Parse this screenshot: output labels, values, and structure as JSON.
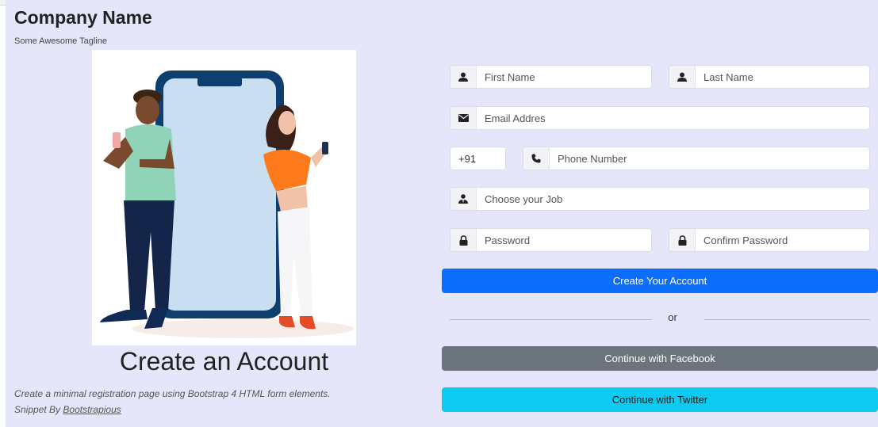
{
  "brand": {
    "name": "Company Name",
    "tagline": "Some Awesome Tagline"
  },
  "hero": {
    "title": "Create an Account",
    "description": "Create a minimal registration page using Bootstrap 4 HTML form elements.",
    "credit_prefix": "Snippet By",
    "credit_link": "Bootstrapious"
  },
  "form": {
    "first_name": {
      "placeholder": "First Name",
      "icon": "user-icon"
    },
    "last_name": {
      "placeholder": "Last Name",
      "icon": "user-icon"
    },
    "email": {
      "placeholder": "Email Addres",
      "icon": "envelope-icon"
    },
    "country_code": {
      "value": "+91"
    },
    "phone": {
      "placeholder": "Phone Number",
      "icon": "phone-icon"
    },
    "job": {
      "placeholder": "Choose your Job",
      "icon": "user-tie-icon"
    },
    "password": {
      "placeholder": "Password",
      "icon": "lock-icon"
    },
    "confirm_password": {
      "placeholder": "Confirm Password",
      "icon": "lock-icon"
    },
    "submit_label": "Create Your Account",
    "divider_text": "or",
    "facebook_label": "Continue with Facebook",
    "twitter_label": "Continue with Twitter"
  },
  "colors": {
    "page_background": "#e6e6fb",
    "primary": "#0d6efd",
    "facebook": "#6c757d",
    "twitter": "#0dcaf0"
  }
}
